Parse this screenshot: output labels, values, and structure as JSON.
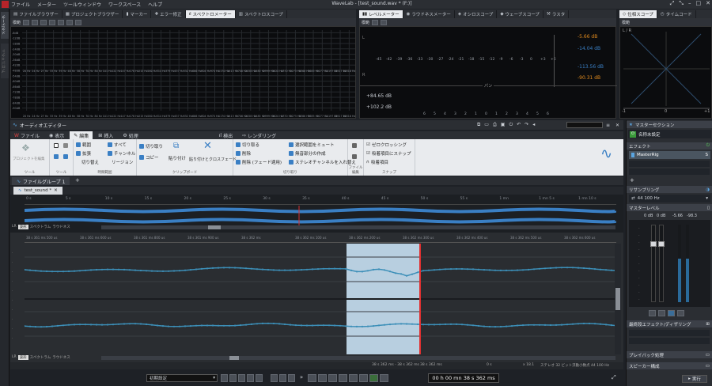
{
  "app": {
    "title": "WaveLab - [test_sound.wav * (F:)]",
    "menu": [
      "ファイル",
      "メーター",
      "ツールウィンドウ",
      "ワークスペース",
      "ヘルプ"
    ]
  },
  "top_tabs_left": [
    "ファイルブラウザー",
    "プロジェクトブラウザー",
    "マーカー",
    "エラー修正",
    "スペクトロメーター",
    "スペクトロスコープ"
  ],
  "top_tabs_mid": [
    "レベルメーター",
    "ラウドネスメーター",
    "オシロスコープ",
    "ウェーブスコープ",
    "ラスタ"
  ],
  "top_tabs_right": [
    "位相スコープ",
    "タイムコード"
  ],
  "left_vertical_tabs": [
    "メタデータ",
    "プロジェクト"
  ],
  "spectrum": {
    "db_labels": [
      "-6dB",
      "-12dB",
      "-18dB",
      "-24dB",
      "-30dB",
      "-36dB",
      "-42dB",
      "-48dB",
      "-54dB",
      "-60dB",
      "-66dB",
      "-72dB",
      "-78dB",
      "-84dB",
      "-90dB"
    ],
    "freq_labels": [
      "20 Hz",
      "24 Hz",
      "27 Hz",
      "33 Hz",
      "39 Hz",
      "48 Hz",
      "58 Hz",
      "70 Hz",
      "84 Hz",
      "101 Hz",
      "122 Hz",
      "147 Hz",
      "178 Hz",
      "215 Hz",
      "260 Hz",
      "314 Hz",
      "379 Hz",
      "457 Hz",
      "552 Hz",
      "666 Hz",
      "804 Hz",
      "970 Hz",
      "1170 Hz",
      "1413 Hz",
      "1706 Hz",
      "2058 Hz",
      "2485 Hz",
      "2999 Hz",
      "3620 Hz",
      "4370 Hz",
      "5275 Hz",
      "6366 Hz",
      "7685 Hz",
      "9277 Hz",
      "11197 Hz",
      "13517 Hz",
      "16316 Hz"
    ]
  },
  "level_meter": {
    "label": "模範",
    "scale": [
      "-45",
      "-42",
      "-39",
      "-36",
      "-33",
      "-30",
      "-27",
      "-24",
      "-21",
      "-18",
      "-15",
      "-12",
      "-9",
      "-6",
      "-3",
      "0",
      "+3",
      "+6"
    ],
    "peak_values": [
      "-5.66 dB",
      "-14.04 dB",
      "-113.56 dB",
      "-90.31 dB"
    ],
    "bottom_values": [
      "+84.65 dB",
      "+102.2 dB"
    ],
    "pan_label": "パン",
    "pan_scale": [
      "6",
      "5",
      "4",
      "3",
      "2",
      "1",
      "0",
      "1",
      "2",
      "3",
      "4",
      "5",
      "6"
    ],
    "colors": {
      "orange": "#e08a1e",
      "blue": "#3a7fc4"
    }
  },
  "phase_scope": {
    "label": "模範",
    "lr": "L / R",
    "axis": [
      "-1",
      "0",
      "+1"
    ]
  },
  "audio_editor": {
    "title": "オーディオエディター",
    "ribbon_tabs": [
      "ファイル",
      "表示",
      "編集",
      "挿入",
      "処理",
      "検出",
      "レンダリング"
    ],
    "active_tab": "編集",
    "groups": [
      "ツール",
      "ツール",
      "時間範囲",
      "クリップボード",
      "切り取り",
      "ファイル編集",
      "スナップ"
    ],
    "items": {
      "project_edit": "プロジェクトを編集",
      "range": "範囲",
      "all": "すべて",
      "expand": "拡張",
      "channel": "チャンネル",
      "switch": "切り替え",
      "region": "リージョン",
      "cut": "切り取り",
      "copy": "コピー",
      "paste": "貼り付け",
      "paste_crossfade": "貼り付けとクロスフェード",
      "trim": "切り取る",
      "delete": "削除",
      "delete_fade": "削除 (フェード適用)",
      "mute_selection": "選択範囲をミュート",
      "create_silence": "無音部分の作成",
      "swap_stereo": "ステレオチャンネルを入れ替え",
      "zero_crossing": "ゼロクロッシング",
      "snap_magnetic": "吸着項目にスナップ",
      "magnetic": "吸着項目"
    },
    "file_group": "ファイルグループ 1",
    "file_tab": "test_sound *",
    "overview_times": [
      "0 s",
      "5 s",
      "10 s",
      "15 s",
      "20 s",
      "25 s",
      "30 s",
      "35 s",
      "40 s",
      "45 s",
      "50 s",
      "55 s",
      "1 mn",
      "1 mn 5 s",
      "1 mn 10 s"
    ],
    "main_times": [
      "38 s 361 ms 500 us",
      "38 s 361 ms 600 us",
      "38 s 361 ms 800 us",
      "38 s 361 ms 900 us",
      "38 s 362 ms",
      "38 s 362 ms 100 us",
      "38 s 362 ms 200 us",
      "38 s 362 ms 300 us",
      "38 s 362 ms 400 us",
      "38 s 362 ms 500 us",
      "38 s 362 ms 600 us"
    ],
    "view_modes": [
      "LR",
      "波形",
      "スペクトラム",
      "ラウドネス"
    ],
    "status": {
      "selection": "38 s 362 ms - 38 s 362 ms",
      "cursor": "38 s 362 ms",
      "zero": "0 s",
      "zoom": "x 18.1",
      "format": "ステレオ 32 ビット浮動小数点 44 100 Hz"
    },
    "transport_preset": "初期設定",
    "time_display": "00 h 00 mn 38 s 362 ms"
  },
  "master": {
    "title": "マスターセクション",
    "preset": "名称未設定",
    "effects_label": "エフェクト",
    "effect_plugin": "MasterRig",
    "resampling_label": "リサンプリング",
    "resampling_value": "44 100 Hz",
    "master_level_label": "マスターレベル",
    "level_values": [
      "0 dB",
      "0 dB",
      "-5.66",
      "-98.3"
    ],
    "final_effects_label": "最終段エフェクト/ディザリング",
    "playback_label": "プレイバック処理",
    "speaker_label": "スピーカー構成",
    "run_label": "実行"
  }
}
